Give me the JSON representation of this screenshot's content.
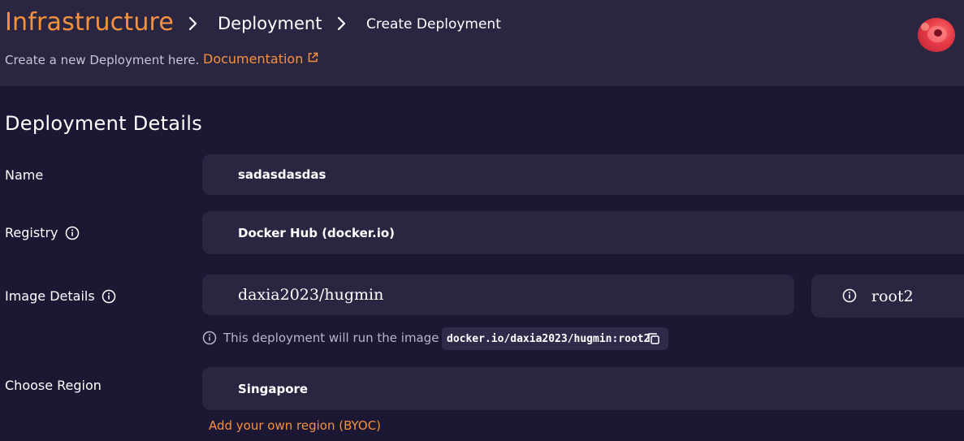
{
  "breadcrumb": {
    "root": "Infrastructure",
    "middle": "Deployment",
    "current": "Create Deployment"
  },
  "header": {
    "subtitle": "Create a new Deployment here.",
    "documentation_link": "Documentation"
  },
  "section": {
    "title": "Deployment Details"
  },
  "form": {
    "name": {
      "label": "Name",
      "value": "sadasdasdas"
    },
    "registry": {
      "label": "Registry",
      "value": "Docker Hub (docker.io)"
    },
    "image": {
      "label": "Image Details",
      "repository": "daxia2023/hugmin",
      "tag": "root2"
    },
    "hint": {
      "text": "This deployment will run the image",
      "full_image": "docker.io/daxia2023/hugmin:root2"
    },
    "region": {
      "label": "Choose Region",
      "value": "Singapore",
      "byoc_link": "Add your own region (BYOC)"
    }
  },
  "colors": {
    "accent": "#f5923e",
    "background": "#1c1733",
    "header_background": "#2a2642",
    "field_background": "#2a2642"
  },
  "icons": {
    "breadcrumb_separator": "chevron-right-icon",
    "external_link": "external-link-icon",
    "info": "info-icon",
    "copy": "copy-icon"
  }
}
